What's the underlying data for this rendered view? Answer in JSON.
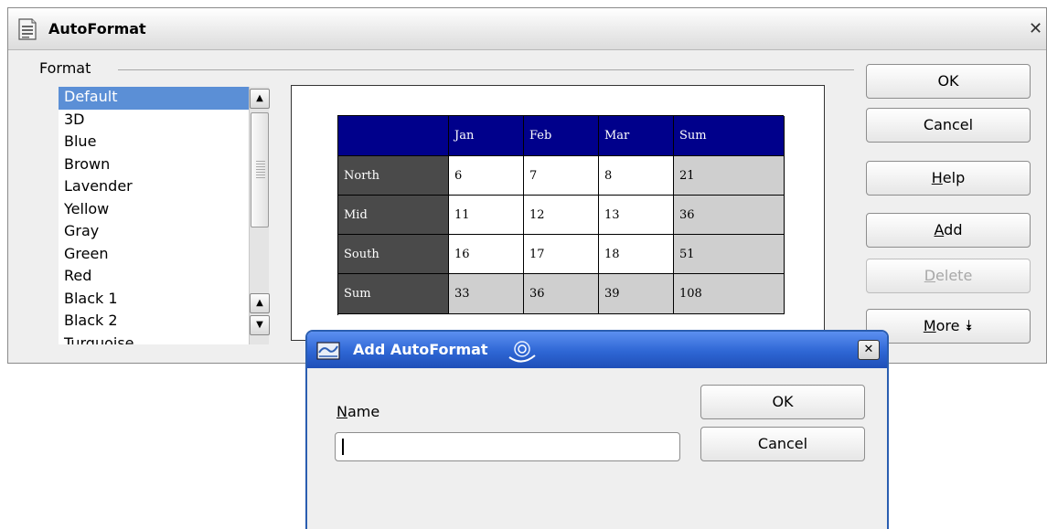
{
  "window": {
    "title": "AutoFormat",
    "close_glyph": "✕",
    "title_icon": "autoformat-icon"
  },
  "format_frame": {
    "label": "Format",
    "items": [
      "Default",
      "3D",
      "Blue",
      "Brown",
      "Lavender",
      "Yellow",
      "Gray",
      "Green",
      "Red",
      "Black 1",
      "Black 2",
      "Turquoise"
    ],
    "selected_index": 0
  },
  "preview_table": {
    "headers": [
      "",
      "Jan",
      "Feb",
      "Mar",
      "Sum"
    ],
    "rows": [
      {
        "label": "North",
        "values": [
          "6",
          "7",
          "8",
          "21"
        ]
      },
      {
        "label": "Mid",
        "values": [
          "11",
          "12",
          "13",
          "36"
        ]
      },
      {
        "label": "South",
        "values": [
          "16",
          "17",
          "18",
          "51"
        ]
      },
      {
        "label": "Sum",
        "values": [
          "33",
          "36",
          "39",
          "108"
        ]
      }
    ],
    "colors": {
      "header": "#00008b",
      "side": "#4a4a4a",
      "sum": "#cfcfcf"
    }
  },
  "buttons": {
    "ok": {
      "pre": "",
      "key": "",
      "post": "OK"
    },
    "cancel": {
      "pre": "",
      "key": "",
      "post": "Cancel"
    },
    "help": {
      "pre": "",
      "key": "H",
      "post": "elp"
    },
    "add": {
      "pre": "",
      "key": "A",
      "post": "dd"
    },
    "delete": {
      "pre": "",
      "key": "D",
      "post": "elete"
    },
    "more": {
      "pre": "",
      "key": "M",
      "post": "ore",
      "icon": "⯯"
    }
  },
  "add_dialog": {
    "title": "Add AutoFormat",
    "close_glyph": "✕",
    "name_label": {
      "key": "N",
      "post": "ame"
    },
    "name_value": "",
    "ok": "OK",
    "cancel": "Cancel"
  }
}
